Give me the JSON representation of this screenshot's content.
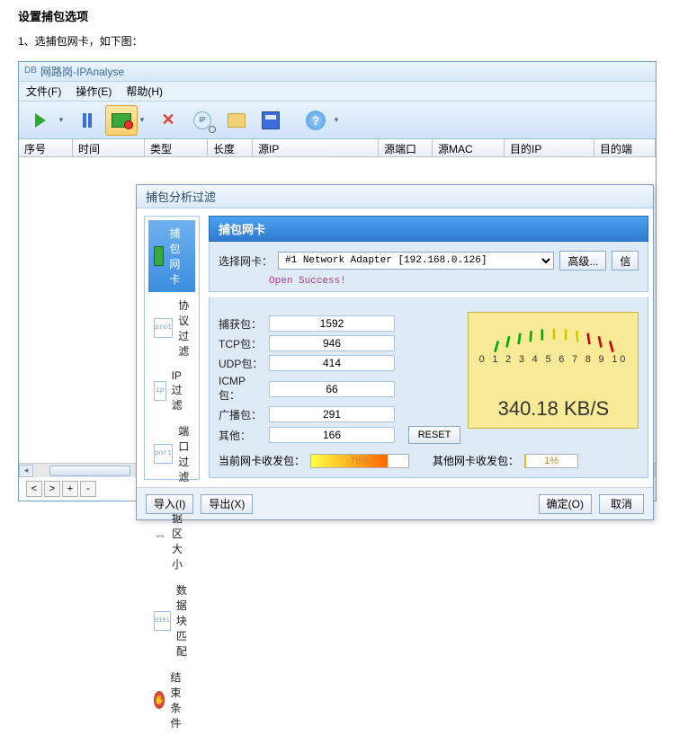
{
  "doc": {
    "title": "设置捕包选项",
    "step1": "1、选捕包网卡，如下图："
  },
  "app": {
    "title": "网路岗-IPAnalyse",
    "titlebar_prefix": "DB"
  },
  "menu": {
    "file": "文件(F)",
    "operate": "操作(E)",
    "help": "帮助(H)"
  },
  "columns": {
    "seq": "序号",
    "time": "时间",
    "type": "类型",
    "length": "长度",
    "srcip": "源IP",
    "srcport": "源端口",
    "srcmac": "源MAC",
    "dstip": "目的IP",
    "dstport": "目的端"
  },
  "dialog": {
    "title": "捕包分析过滤",
    "sidebar": {
      "nic": "捕包网卡",
      "proto": "协议过滤",
      "ip": "IP过滤",
      "port": "端口过滤",
      "size": "数据区大小",
      "block": "数据块匹配",
      "stop": "结束条件"
    },
    "panel_title": "捕包网卡",
    "select_label": "选择网卡：",
    "adapter_value": "#1 Network Adapter [192.168.0.126]",
    "btn_advanced": "高级...",
    "btn_info": "信",
    "status": "Open Success!",
    "stats": {
      "captured_lbl": "捕获包：",
      "captured_val": "1592",
      "tcp_lbl": "TCP包：",
      "tcp_val": "946",
      "udp_lbl": "UDP包：",
      "udp_val": "414",
      "icmp_lbl": "ICMP包：",
      "icmp_val": "66",
      "bcast_lbl": "广播包：",
      "bcast_val": "291",
      "other_lbl": "其他：",
      "other_val": "166"
    },
    "gauge": {
      "scale": "0 1 2 3 4 5 6 7 8 9 10",
      "rate": "340.18 KB/S"
    },
    "reset": "RESET",
    "rx": {
      "cur_lbl": "当前网卡收发包：",
      "cur_pct": "79%",
      "other_lbl": "其他网卡收发包：",
      "other_pct": "1%"
    },
    "footer": {
      "import": "导入(I)",
      "export": "导出(X)",
      "ok": "确定(O)",
      "cancel": "取消"
    }
  }
}
